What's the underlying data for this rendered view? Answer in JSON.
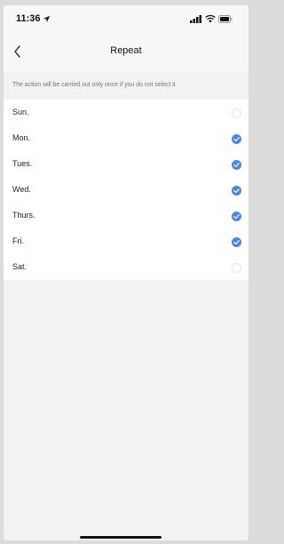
{
  "status": {
    "time": "11:36"
  },
  "nav": {
    "title": "Repeat"
  },
  "hint": "The action will be carried out only once if you do not select it.",
  "days": [
    {
      "label": "Sun.",
      "selected": false
    },
    {
      "label": "Mon.",
      "selected": true
    },
    {
      "label": "Tues.",
      "selected": true
    },
    {
      "label": "Wed.",
      "selected": true
    },
    {
      "label": "Thurs.",
      "selected": true
    },
    {
      "label": "Fri.",
      "selected": true
    },
    {
      "label": "Sat.",
      "selected": false
    }
  ],
  "colors": {
    "accent": "#4a86e8",
    "background": "#f2f2f2",
    "list": "#ffffff"
  }
}
